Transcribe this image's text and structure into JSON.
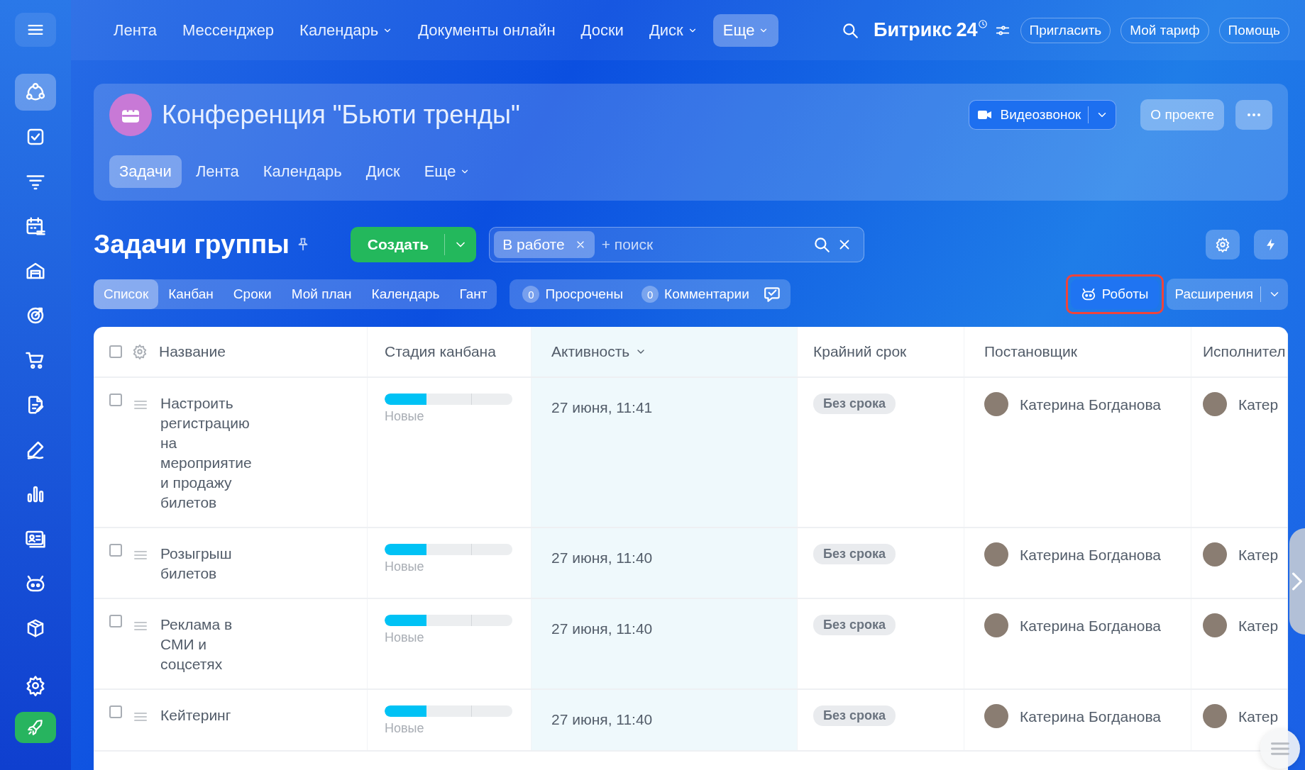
{
  "sidebar": {
    "items": [
      {
        "selected": true
      },
      {
        "selected": false
      },
      {
        "selected": false
      },
      {
        "selected": false
      },
      {
        "selected": false
      },
      {
        "selected": false
      },
      {
        "selected": false
      },
      {
        "selected": false
      },
      {
        "selected": false
      },
      {
        "selected": false
      },
      {
        "selected": false
      },
      {
        "selected": false
      },
      {
        "selected": false
      }
    ]
  },
  "top_nav": {
    "items": [
      {
        "label": "Лента",
        "dropdown": false,
        "selected": false
      },
      {
        "label": "Мессенджер",
        "dropdown": false,
        "selected": false
      },
      {
        "label": "Календарь",
        "dropdown": true,
        "selected": false
      },
      {
        "label": "Документы онлайн",
        "dropdown": false,
        "selected": false
      },
      {
        "label": "Доски",
        "dropdown": false,
        "selected": false
      },
      {
        "label": "Диск",
        "dropdown": true,
        "selected": false
      },
      {
        "label": "Еще",
        "dropdown": true,
        "selected": true
      }
    ],
    "logo": "Битрикс",
    "logo_number": "24",
    "buttons": [
      "Пригласить",
      "Мой тариф",
      "Помощь"
    ]
  },
  "group": {
    "title": "Конференция \"Бьюти тренды\"",
    "video_button": "Видеозвонок",
    "about_button": "О проекте",
    "tabs": [
      {
        "label": "Задачи",
        "dropdown": false,
        "selected": true
      },
      {
        "label": "Лента",
        "dropdown": false,
        "selected": false
      },
      {
        "label": "Календарь",
        "dropdown": false,
        "selected": false
      },
      {
        "label": "Диск",
        "dropdown": false,
        "selected": false
      },
      {
        "label": "Еще",
        "dropdown": true,
        "selected": false
      }
    ]
  },
  "page": {
    "title": "Задачи группы",
    "create_button": "Создать",
    "filter_chip": "В работе",
    "search": {
      "placeholder": "+ поиск"
    }
  },
  "views": [
    {
      "label": "Список",
      "selected": true
    },
    {
      "label": "Канбан",
      "selected": false
    },
    {
      "label": "Сроки",
      "selected": false
    },
    {
      "label": "Мой план",
      "selected": false
    },
    {
      "label": "Календарь",
      "selected": false
    },
    {
      "label": "Гант",
      "selected": false
    }
  ],
  "counters": [
    {
      "count": "0",
      "label": "Просрочены"
    },
    {
      "count": "0",
      "label": "Комментарии"
    }
  ],
  "robots_button": {
    "label": "Роботы",
    "highlighted": true
  },
  "extensions_button": "Расширения",
  "table": {
    "all_checked": false,
    "columns": [
      {
        "label": "Название",
        "sorted": false,
        "highlighted": false
      },
      {
        "label": "Стадия канбана",
        "sorted": false,
        "highlighted": false
      },
      {
        "label": "Активность",
        "sorted": true,
        "highlighted": true
      },
      {
        "label": "Крайний срок",
        "sorted": false,
        "highlighted": false
      },
      {
        "label": "Постановщик",
        "sorted": false,
        "highlighted": false
      },
      {
        "label": "Исполнител",
        "sorted": false,
        "highlighted": false
      }
    ],
    "rows": [
      {
        "checked": false,
        "title": "Настроить регистрацию на мероприятие и продажу билетов",
        "level": 0.33,
        "stage": "Новые",
        "activity": "27 июня, 11:41",
        "deadline": "Без срока",
        "creator": "Катерина Богданова",
        "assignee": "Катер"
      },
      {
        "checked": false,
        "title": "Розыгрыш билетов",
        "level": 0.33,
        "stage": "Новые",
        "activity": "27 июня, 11:40",
        "deadline": "Без срока",
        "creator": "Катерина Богданова",
        "assignee": "Катер"
      },
      {
        "checked": false,
        "title": "Реклама в СМИ и соцсетях",
        "level": 0.33,
        "stage": "Новые",
        "activity": "27 июня, 11:40",
        "deadline": "Без срока",
        "creator": "Катерина Богданова",
        "assignee": "Катер"
      },
      {
        "checked": false,
        "title": "Кейтеринг",
        "level": 0.33,
        "stage": "Новые",
        "activity": "27 июня, 11:40",
        "deadline": "Без срока",
        "creator": "Катерина Богданова",
        "assignee": "Катер"
      }
    ]
  }
}
